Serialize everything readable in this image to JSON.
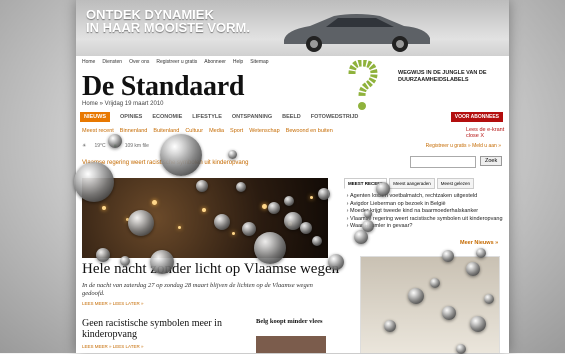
{
  "banner": {
    "line1": "ONTDEK DYNAMIEK",
    "line2": "IN HAAR MOOISTE VORM."
  },
  "topnav": [
    "Home",
    "Diensten",
    "Over ons",
    "Registreer u gratis",
    "Abonneer",
    "Help",
    "Sitemap"
  ],
  "masthead": "De Standaard",
  "crumb": "Home » Vrijdag 19 maart 2010",
  "promo": "WEGWIJS IN DE JUNGLE VAN DE DUURZAAMHEIDSLABELS",
  "nav": [
    "NIEUWS",
    "OPINIES",
    "ECONOMIE",
    "LIFESTYLE",
    "ONTSPANNING",
    "BEELD",
    "FOTOWEDSTRIJD"
  ],
  "abo": "VOOR ABONNEES",
  "subnav": [
    "Meest recent",
    "Binnenland",
    "Buitenland",
    "Cultuur",
    "Media",
    "Sport",
    "Wetenschap",
    "Bewoond en buiten"
  ],
  "read": {
    "line1": "Lees de e-krant",
    "line2": "close X"
  },
  "weather": {
    "temp": "19°C",
    "traffic": "109 km file"
  },
  "weather_links": "Registreer u gratis »  Meld u aan »",
  "ticker": "Vlaamse regering weert racistische symbolen uit kinderopvang",
  "search_button": "Zoek",
  "headline": "Hele nacht zonder licht op Vlaamse wegen",
  "lead": "In de nacht van zaterdag 27 op zondag 28 maart blijven de lichten op de Vlaamse wegen gedoofd.",
  "more_links": "LEES MEER »  LEES LATER »",
  "story2": "Geen racistische symbolen meer in kinderopvang",
  "story3": "Belg koopt minder vlees",
  "tabs": [
    "MEEST RECENT",
    "Meest aangeraden",
    "Meest gelezen"
  ],
  "recent": [
    "Agenten lossen voetbalmatch, rechtzaken uitgesteld",
    "Avigdor Lieberman op bezoek in België",
    "Moeder krijgt tweede kind na baarmoederhalskanker",
    "Vlaamse regering weert racistische symbolen uit kinderopvang",
    "Waar Heumler in gevaar?"
  ],
  "meer_nieuws": "Meer Nieuws »"
}
